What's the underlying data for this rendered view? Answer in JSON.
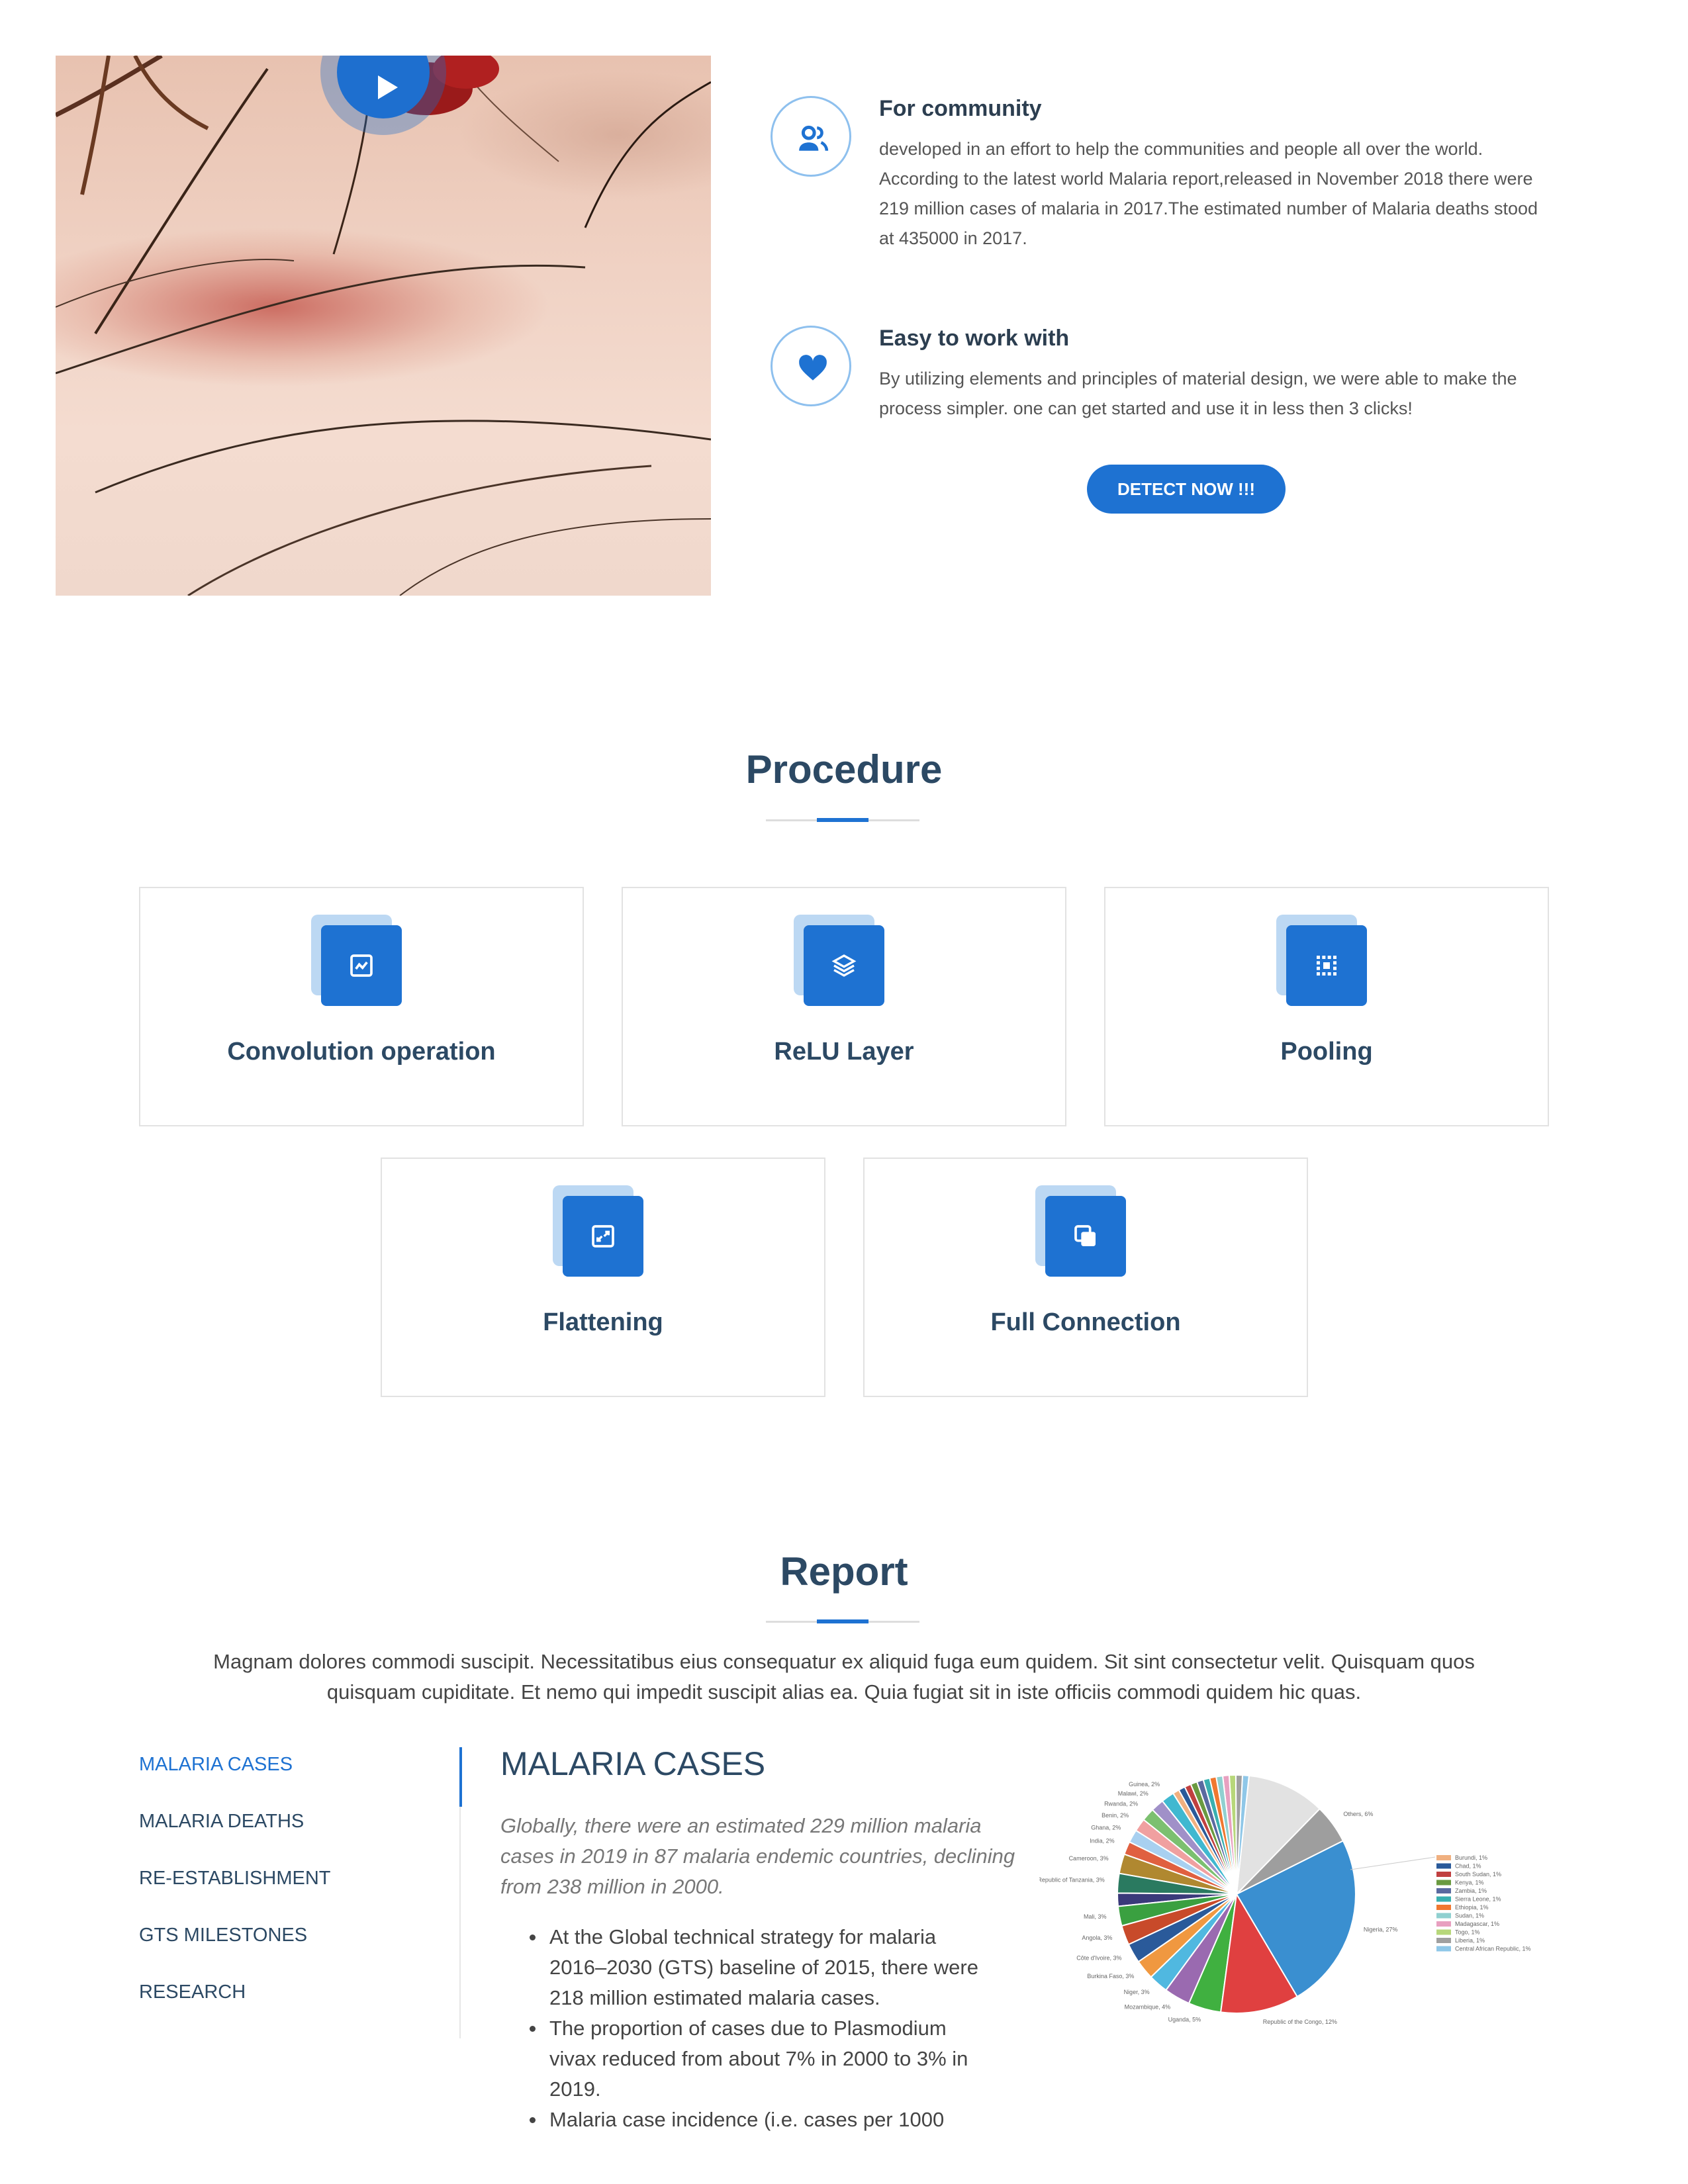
{
  "features": [
    {
      "icon": "users-icon",
      "title": "For community",
      "lines": [
        "developed in an effort to help the communities and people all over the world.",
        "According to the latest world Malaria report,released in November 2018 there were",
        "219 million cases of malaria in 2017.The estimated number of Malaria deaths stood",
        "at 435000 in 2017."
      ]
    },
    {
      "icon": "heart-icon",
      "title": "Easy to work with",
      "lines": [
        "By utilizing elements and principles of material design, we were able to make the",
        "process simpler. one can get started and use it in less then 3 clicks!"
      ]
    }
  ],
  "detect_button": "DETECT NOW !!!",
  "procedure": {
    "title": "Procedure",
    "steps": [
      {
        "label": "Convolution operation",
        "icon": "activity-chart-icon"
      },
      {
        "label": "ReLU Layer",
        "icon": "layers-icon"
      },
      {
        "label": "Pooling",
        "icon": "grid-icon"
      },
      {
        "label": "Flattening",
        "icon": "arrows-collapse-icon"
      },
      {
        "label": "Full Connection",
        "icon": "copy-squares-icon"
      }
    ]
  },
  "report": {
    "title": "Report",
    "intro_lines": [
      "Magnam dolores commodi suscipit. Necessitatibus eius consequatur ex aliquid fuga eum quidem. Sit sint consectetur velit. Quisquam quos",
      "quisquam cupiditate. Et nemo qui impedit suscipit alias ea. Quia fugiat sit in iste officiis commodi quidem hic quas."
    ],
    "nav": [
      "MALARIA CASES",
      "MALARIA DEATHS",
      "RE-ESTABLISHMENT",
      "GTS MILESTONES",
      "RESEARCH"
    ],
    "active_nav": "MALARIA CASES",
    "tab_title": "MALARIA CASES",
    "lead_lines": [
      "Globally, there were an estimated 229 million malaria",
      "cases in 2019 in 87 malaria endemic countries, declining",
      "from 238 million in 2000."
    ],
    "bullets": [
      [
        "At the Global technical strategy for malaria",
        "2016–2030 (GTS) baseline of 2015, there were",
        "218 million estimated malaria cases."
      ],
      [
        "The proportion of cases due to Plasmodium",
        "vivax reduced from about 7% in 2000 to 3% in",
        "2019."
      ],
      [
        "Malaria case incidence (i.e. cases per 1000"
      ]
    ]
  },
  "chart_data": {
    "type": "pie",
    "slices": [
      {
        "name": "Nigeria",
        "value": 27,
        "label": "Nigeria, 27%",
        "color": "#3a8fd0"
      },
      {
        "name": "Others",
        "value": 6,
        "label": "Others, 6%",
        "color": "#9e9e9e"
      },
      {
        "name": "Unlabeled",
        "value": 12,
        "label": "",
        "color": "#e2e2e2"
      },
      {
        "name": "Central African Republic",
        "value": 1,
        "label": "Central African Republic, 1%",
        "color": "#8fc7e8"
      },
      {
        "name": "Liberia",
        "value": 1,
        "label": "Liberia, 1%",
        "color": "#a0a0a0"
      },
      {
        "name": "Togo",
        "value": 1,
        "label": "Togo, 1%",
        "color": "#b7d77a"
      },
      {
        "name": "Madagascar",
        "value": 1,
        "label": "Madagascar, 1%",
        "color": "#e8a0c0"
      },
      {
        "name": "Sudan",
        "value": 1,
        "label": "Sudan, 1%",
        "color": "#90d0d0"
      },
      {
        "name": "Ethiopia",
        "value": 1,
        "label": "Ethiopia, 1%",
        "color": "#f07830"
      },
      {
        "name": "Sierra Leone",
        "value": 1,
        "label": "Sierra Leone, 1%",
        "color": "#3ab0b0"
      },
      {
        "name": "Zambia",
        "value": 1,
        "label": "Zambia, 1%",
        "color": "#5a6aa0"
      },
      {
        "name": "Kenya",
        "value": 1,
        "label": "Kenya, 1%",
        "color": "#6a9a40"
      },
      {
        "name": "South Sudan",
        "value": 1,
        "label": "South Sudan, 1%",
        "color": "#c04040"
      },
      {
        "name": "Chad",
        "value": 1,
        "label": "Chad, 1%",
        "color": "#2a5a9a"
      },
      {
        "name": "Burundi",
        "value": 1,
        "label": "Burundi, 1%",
        "color": "#f0b080"
      },
      {
        "name": "Guinea",
        "value": 2,
        "label": "Guinea, 2%",
        "color": "#40b8d0"
      },
      {
        "name": "Malawi",
        "value": 2,
        "label": "Malawi, 2%",
        "color": "#a090c8"
      },
      {
        "name": "Rwanda",
        "value": 2,
        "label": "Rwanda, 2%",
        "color": "#7cc070"
      },
      {
        "name": "Benin",
        "value": 2,
        "label": "Benin, 2%",
        "color": "#f0a0a0"
      },
      {
        "name": "Ghana",
        "value": 2,
        "label": "Ghana, 2%",
        "color": "#a8d0f0"
      },
      {
        "name": "India",
        "value": 2,
        "label": "India, 2%",
        "color": "#e06040"
      },
      {
        "name": "Cameroon",
        "value": 3,
        "label": "Cameroon, 3%",
        "color": "#b08830"
      },
      {
        "name": "United Republic of Tanzania",
        "value": 3,
        "label": "United Republic of Tanzania, 3%",
        "color": "#2a7a60"
      },
      {
        "name": "Unlabeled",
        "value": 2,
        "label": "",
        "color": "#3a3a7a"
      },
      {
        "name": "Mali",
        "value": 3,
        "label": "Mali, 3%",
        "color": "#3aa040"
      },
      {
        "name": "Angola",
        "value": 3,
        "label": "Angola, 3%",
        "color": "#c84a2a"
      },
      {
        "name": "Côte d'Ivoire",
        "value": 3,
        "label": "Côte d'Ivoire, 3%",
        "color": "#2a5a9a"
      },
      {
        "name": "Burkina Faso",
        "value": 3,
        "label": "Burkina Faso, 3%",
        "color": "#f09840"
      },
      {
        "name": "Niger",
        "value": 3,
        "label": "Niger, 3%",
        "color": "#50b8e0"
      },
      {
        "name": "Mozambique",
        "value": 4,
        "label": "Mozambique, 4%",
        "color": "#9a6ab0"
      },
      {
        "name": "Uganda",
        "value": 5,
        "label": "Uganda, 5%",
        "color": "#40b040"
      },
      {
        "name": "Democratic Republic of the Congo",
        "value": 12,
        "label": "Republic of the Congo, 12%",
        "color": "#e04040"
      }
    ],
    "legend": [
      "Burundi, 1%",
      "Chad, 1%",
      "South Sudan, 1%",
      "Kenya, 1%",
      "Zambia, 1%",
      "Sierra Leone, 1%",
      "Ethiopia, 1%",
      "Sudan, 1%",
      "Madagascar, 1%",
      "Togo, 1%",
      "Liberia, 1%",
      "Central African Republic, 1%"
    ],
    "legend_position": "right"
  }
}
